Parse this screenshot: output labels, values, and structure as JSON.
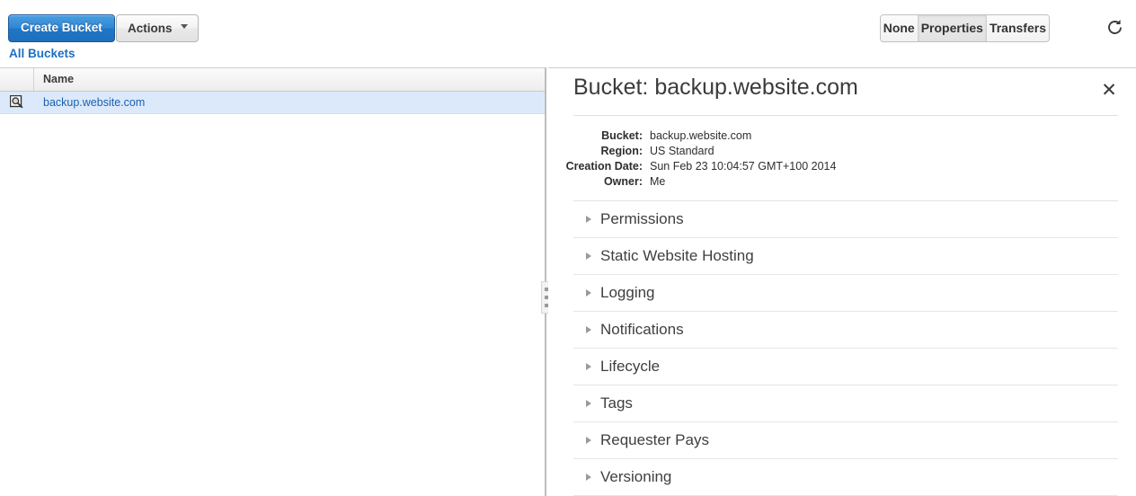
{
  "toolbar": {
    "create_bucket_label": "Create Bucket",
    "actions_label": "Actions",
    "caret_icon": "chevron-down-icon",
    "refresh_icon": "refresh-icon",
    "accent_blue": "#2076c6",
    "segmented": {
      "options": [
        "None",
        "Properties",
        "Transfers"
      ],
      "selected": "Properties"
    }
  },
  "breadcrumb": {
    "label": "All Buckets",
    "color": "#1b70c4"
  },
  "bucket_list": {
    "columns": [
      "",
      "Name"
    ],
    "column_name_header": "Name",
    "rows": [
      {
        "icon": "magnifier-bucket-icon",
        "name": "backup.website.com",
        "selected": true
      }
    ]
  },
  "splitter": {
    "grip_icon": "drag-grip-icon"
  },
  "details_panel": {
    "title": "Bucket: backup.website.com",
    "close_icon": "close-icon",
    "meta": [
      {
        "label": "Bucket:",
        "value": "backup.website.com"
      },
      {
        "label": "Region:",
        "value": "US Standard"
      },
      {
        "label": "Creation Date:",
        "value": "Sun Feb 23 10:04:57 GMT+100 2014"
      },
      {
        "label": "Owner:",
        "value": "Me"
      }
    ],
    "sections": [
      {
        "label": "Permissions",
        "expanded": false
      },
      {
        "label": "Static Website Hosting",
        "expanded": false
      },
      {
        "label": "Logging",
        "expanded": false
      },
      {
        "label": "Notifications",
        "expanded": false
      },
      {
        "label": "Lifecycle",
        "expanded": false
      },
      {
        "label": "Tags",
        "expanded": false
      },
      {
        "label": "Requester Pays",
        "expanded": false
      },
      {
        "label": "Versioning",
        "expanded": false
      }
    ]
  }
}
